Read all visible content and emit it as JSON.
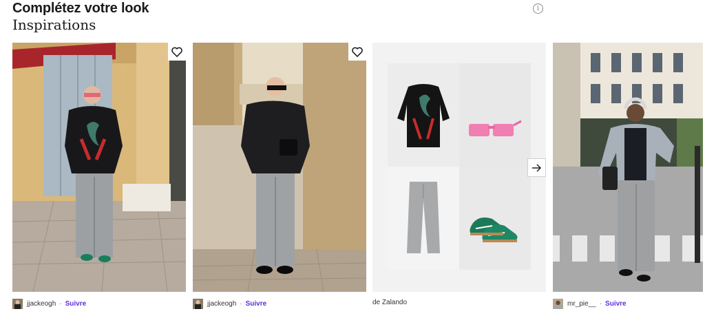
{
  "header": {
    "title": "Complétez votre look",
    "subtitle": "Inspirations",
    "info_icon": "info-icon"
  },
  "cards": [
    {
      "type": "photo",
      "user": "jjackeogh",
      "follow": "Suivre",
      "favorite_icon": "heart-icon"
    },
    {
      "type": "photo",
      "user": "jjackeogh",
      "follow": "Suivre",
      "favorite_icon": "heart-icon"
    },
    {
      "type": "product-collage",
      "source": "de Zalando",
      "next_icon": "arrow-right-icon"
    },
    {
      "type": "photo",
      "user": "mr_pie__",
      "follow": "Suivre"
    }
  ],
  "separator": "·"
}
